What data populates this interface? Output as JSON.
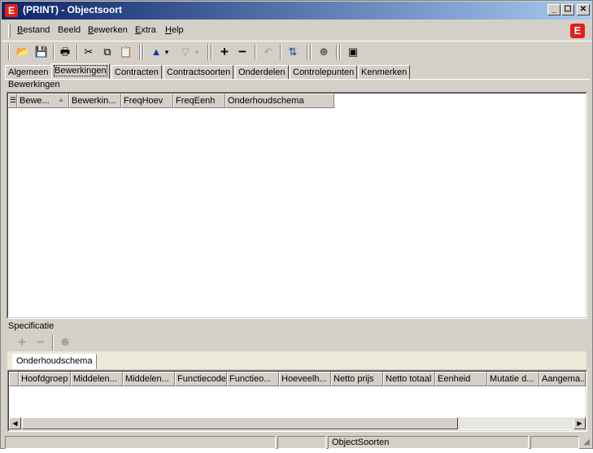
{
  "window": {
    "title": "(PRINT) - Objectsoort",
    "app_icon_letter": "E",
    "minimize_glyph": "_",
    "maximize_glyph": "☐",
    "close_glyph": "✕"
  },
  "menubar": {
    "items": [
      {
        "underline": "B",
        "rest": "estand"
      },
      {
        "underline": "",
        "rest": "Beeld"
      },
      {
        "underline": "B",
        "rest": "ewerken"
      },
      {
        "underline": "E",
        "rest": "xtra"
      },
      {
        "underline": "H",
        "rest": "elp"
      }
    ],
    "logo_letter": "E"
  },
  "toolbar": {
    "icons": [
      "open-icon",
      "save-icon",
      "print-icon",
      "cut-icon",
      "copy-icon",
      "paste-icon",
      "arrow-up-icon",
      "dropdown-icon",
      "arrow-down-icon",
      "dropdown-icon",
      "plus-icon",
      "minus-icon",
      "undo-icon",
      "refresh-icon",
      "user-icon",
      "window-icon"
    ],
    "glyphs": [
      "📂",
      "💾",
      "🖶",
      "✂",
      "⧉",
      "📋",
      "▲",
      "▾",
      "▽",
      "▾",
      "+",
      "−",
      "↶",
      "⇅",
      "☻",
      "▣"
    ]
  },
  "tabs": [
    "Algemeen",
    "Bewerkingen",
    "Contracten",
    "Contractsoorten",
    "Onderdelen",
    "Controlepunten",
    "Kenmerken"
  ],
  "active_tab": "Bewerkingen",
  "bewerkingen": {
    "label": "Bewerkingen",
    "columns": [
      "Bewe...",
      "Bewerkin...",
      "FreqHoev",
      "FreqEenh",
      "Onderhoudschema"
    ],
    "sort_glyph": "▲"
  },
  "specificatie": {
    "label": "Specificatie",
    "toolbar_glyphs": [
      "+",
      "−",
      "☻"
    ],
    "subtabs": [
      "Onderhoudschema"
    ],
    "columns": [
      "Hoofdgroep",
      "Middelen...",
      "Middelen...",
      "Functiecode",
      "Functieo...",
      "Hoeveelh...",
      "Netto prijs",
      "Netto totaal",
      "Eenheid",
      "Mutatie d...",
      "Aangema..."
    ],
    "scroll_left": "◀",
    "scroll_right": "▶"
  },
  "statusbar": {
    "panels": [
      "",
      "",
      "ObjectSoorten",
      ""
    ]
  },
  "colors": {
    "brand_red": "#e0201a",
    "title_active_start": "#0a246a",
    "face": "#d4d0c8"
  }
}
